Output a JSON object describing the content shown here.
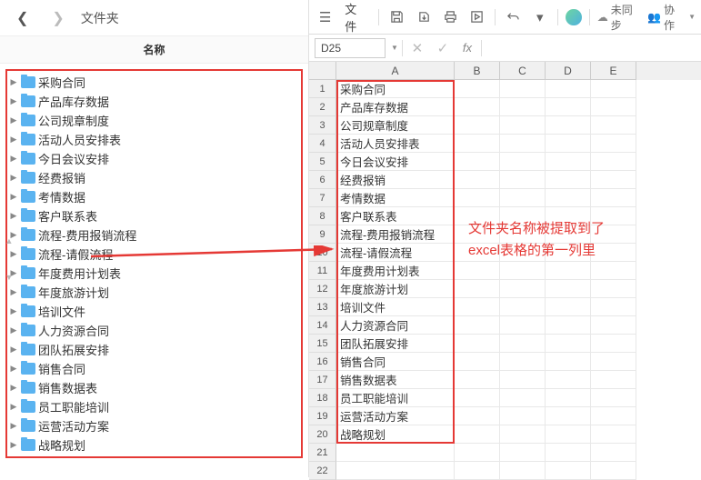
{
  "left": {
    "title": "文件夹",
    "columnHeader": "名称",
    "items": [
      "采购合同",
      "产品库存数据",
      "公司规章制度",
      "活动人员安排表",
      "今日会议安排",
      "经费报销",
      "考情数据",
      "客户联系表",
      "流程-费用报销流程",
      "流程-请假流程",
      "年度费用计划表",
      "年度旅游计划",
      "培训文件",
      "人力资源合同",
      "团队拓展安排",
      "销售合同",
      "销售数据表",
      "员工职能培训",
      "运营活动方案",
      "战略规划"
    ]
  },
  "right": {
    "menuFile": "文件",
    "syncText": "未同步",
    "collabText": "协作",
    "cellRef": "D25",
    "fxLabel": "fx",
    "columns": [
      "A",
      "B",
      "C",
      "D",
      "E"
    ],
    "rows": [
      "采购合同",
      "产品库存数据",
      "公司规章制度",
      "活动人员安排表",
      "今日会议安排",
      "经费报销",
      "考情数据",
      "客户联系表",
      "流程-费用报销流程",
      "流程-请假流程",
      "年度费用计划表",
      "年度旅游计划",
      "培训文件",
      "人力资源合同",
      "团队拓展安排",
      "销售合同",
      "销售数据表",
      "员工职能培训",
      "运营活动方案",
      "战略规划",
      "",
      ""
    ]
  },
  "annotation": {
    "line1": "文件夹名称被提取到了",
    "line2": "excel表格的第一列里"
  }
}
